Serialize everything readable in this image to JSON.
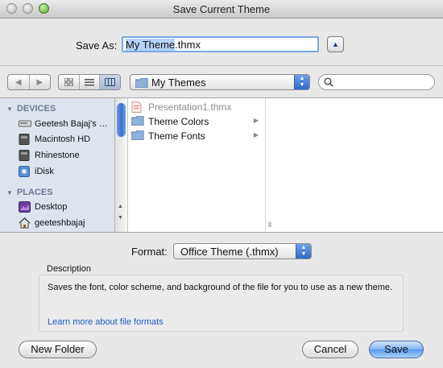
{
  "window": {
    "title": "Save Current Theme"
  },
  "save_as": {
    "label": "Save As:",
    "filename_selected": "My Theme",
    "filename_rest": ".thmx"
  },
  "toolbar": {
    "back_icon": "left-arrow-icon",
    "forward_icon": "right-arrow-icon",
    "view_modes": [
      "icon-view-icon",
      "list-view-icon",
      "column-view-icon"
    ],
    "active_view": "column-view-icon",
    "location": "My Themes",
    "search_value": ""
  },
  "sidebar": {
    "devices_header": "DEVICES",
    "devices": [
      {
        "label": "Geetesh Bajaj's …",
        "icon": "computer-icon"
      },
      {
        "label": "Macintosh HD",
        "icon": "hard-drive-icon"
      },
      {
        "label": "Rhinestone",
        "icon": "hard-drive-icon"
      },
      {
        "label": "iDisk",
        "icon": "idisk-icon"
      }
    ],
    "places_header": "PLACES",
    "places": [
      {
        "label": "Desktop",
        "icon": "desktop-icon"
      },
      {
        "label": "geeteshbajaj",
        "icon": "home-icon"
      }
    ]
  },
  "files": [
    {
      "label": "Presentation1.thmx",
      "icon": "document-icon",
      "dimmed": true
    },
    {
      "label": "Theme Colors",
      "icon": "folder-icon",
      "dimmed": false
    },
    {
      "label": "Theme Fonts",
      "icon": "folder-icon",
      "dimmed": false
    }
  ],
  "format": {
    "label": "Format:",
    "value": "Office Theme (.thmx)"
  },
  "description": {
    "title": "Description",
    "text": "Saves the font, color scheme, and background of the file for you to use as a new theme.",
    "link": "Learn more about file formats"
  },
  "buttons": {
    "new_folder": "New Folder",
    "cancel": "Cancel",
    "save": "Save"
  },
  "colors": {
    "accent": "#5a98ee",
    "link": "#1f5ec9",
    "sidebar_bg": "#dde4ee",
    "selection": "#b5d3ff"
  }
}
